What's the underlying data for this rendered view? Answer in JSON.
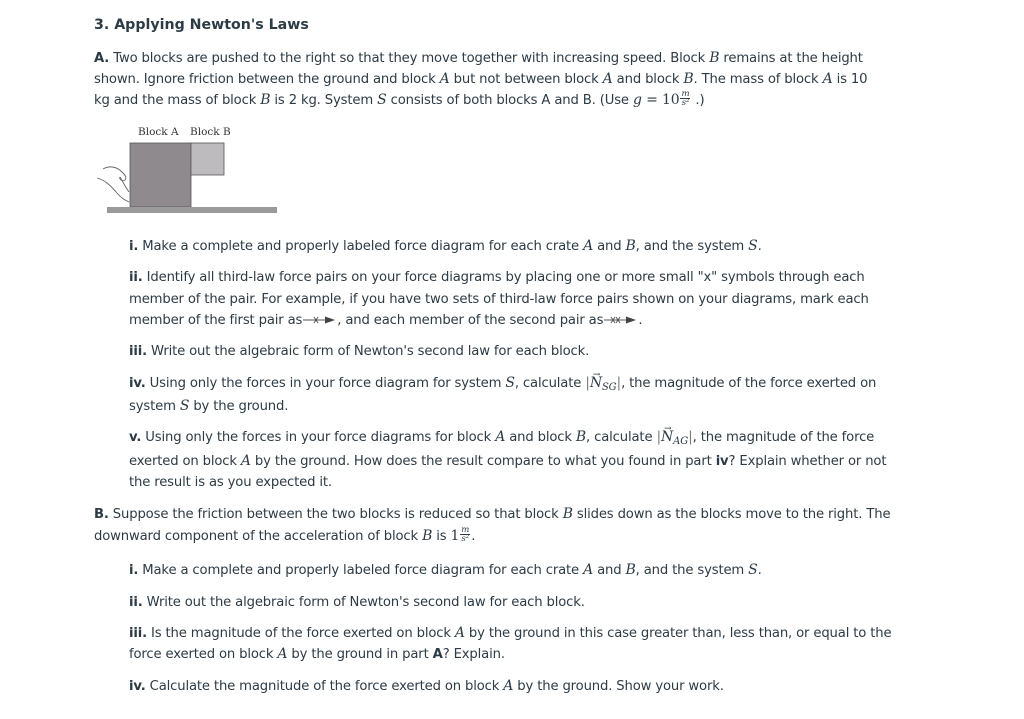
{
  "title": "3. Applying Newton's Laws",
  "partA": {
    "label": "A.",
    "lines": [
      [
        "Two blocks are pushed to the right so that they move together with increasing speed.  Block ",
        "B",
        " remains at the height"
      ],
      [
        "shown.  Ignore friction between the ground and block ",
        "A",
        " but not between block ",
        "A",
        " and block ",
        "B",
        ".  The mass of block ",
        "A",
        " is 10"
      ],
      [
        "kg and the mass of block ",
        "B",
        " is 2 kg.  System ",
        "S",
        " consists of both blocks A and B. (Use "
      ]
    ],
    "g_symbol": "g",
    "g_eq": " = 10",
    "g_unit_num": "m",
    "g_unit_den": "s²",
    "g_close": " .)"
  },
  "figure": {
    "label_a": "Block A",
    "label_b": "Block B",
    "block_a_color": "#8e8a8e",
    "block_b_color": "#bdbbbd",
    "ground_color": "#9a9a9a"
  },
  "partA_questions": {
    "i": {
      "num": "i.",
      "text1": " Make a complete and properly labeled force diagram for each crate ",
      "A": "A",
      "and": " and ",
      "B": "B",
      "text2": ", and the system ",
      "S": "S",
      "end": "."
    },
    "ii": {
      "num": "ii.",
      "line1": " Identify all third-law force pairs on your force diagrams by placing one or more small \"x\" symbols through each",
      "line2": "member of the pair.  For example, if you have two sets of third-law force pairs shown on your diagrams, mark each",
      "line3a": "member of the first pair as",
      "line3b": ", and each member of the second pair as",
      "line3c": "."
    },
    "iii": {
      "num": "iii.",
      "text": " Write out the algebraic form of Newton's second law for each block."
    },
    "iv": {
      "num": "iv.",
      "line1a": " Using only the forces in your force diagram for system ",
      "S": "S",
      "line1b": ", calculate ",
      "N": "N",
      "N_sub": "SG",
      "line1c": ", the magnitude of the force exerted on",
      "line2a": "system ",
      "line2b": " by the ground."
    },
    "v": {
      "num": "v.",
      "line1a": " Using only the forces in your force diagrams for block ",
      "A": "A",
      "line1b": " and block ",
      "B": "B",
      "line1c": ", calculate ",
      "N": "N",
      "N_sub": "AG",
      "line1d": ", the magnitude of the force",
      "line2a": "exerted on block ",
      "line2b": " by the ground.  How does the result compare to what you found in part ",
      "line2bold": "iv",
      "line2c": "?  Explain whether or not",
      "line3": "the result is as you expected it."
    }
  },
  "partB": {
    "label": "B.",
    "line1a": " Suppose the friction between the two blocks is reduced so that block ",
    "B": "B",
    "line1b": " slides down as the blocks move to the right. The",
    "line2a": "downward component of the acceleration of block ",
    "line2b": " is ",
    "accel_value": "1",
    "accel_num": "m",
    "accel_den": "s²",
    "line2c": "."
  },
  "partB_questions": {
    "i": {
      "num": "i.",
      "text1": " Make a complete and properly labeled force diagram for each crate ",
      "A": "A",
      "and": " and ",
      "B": "B",
      "text2": ", and the system ",
      "S": "S",
      "end": "."
    },
    "ii": {
      "num": "ii.",
      "text": " Write out the algebraic form of Newton's second law for each block."
    },
    "iii": {
      "num": "iii.",
      "line1a": " Is the magnitude of the force exerted on block ",
      "A": "A",
      "line1b": " by the ground in this case greater than, less than, or equal to the",
      "line2a": "force exerted on block ",
      "line2b": " by the ground in part ",
      "line2bold": "A",
      "line2c": "?  Explain."
    },
    "iv": {
      "num": "iv.",
      "line1a": " Calculate the magnitude of the force exerted on block ",
      "A": "A",
      "line1b": " by the ground. Show your work."
    }
  }
}
